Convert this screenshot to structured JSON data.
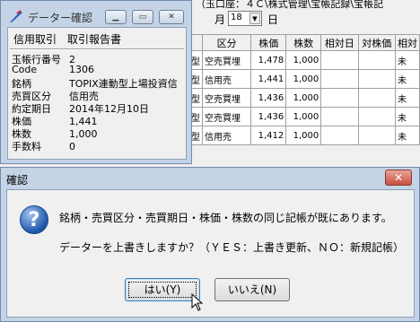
{
  "background": {
    "top_text": "（玉口座：４Ｃ\\株式管理\\宝帳記録\\宝帳記",
    "month_label": "月",
    "day_value": "18",
    "day_label": "日",
    "table": {
      "columns": [
        "区分",
        "株価",
        "株数",
        "相対日",
        "対株価",
        "相対"
      ],
      "rows": [
        [
          "型",
          "空売買埋",
          "1,478",
          "1,000",
          "",
          "",
          "未"
        ],
        [
          "型",
          "信用売",
          "1,441",
          "1,000",
          "",
          "",
          "未"
        ],
        [
          "型",
          "空売買埋",
          "1,436",
          "1,000",
          "",
          "",
          "未"
        ],
        [
          "型",
          "空売買埋",
          "1,436",
          "1,000",
          "",
          "",
          "未"
        ],
        [
          "型",
          "信用売",
          "1,412",
          "1,000",
          "",
          "",
          "未"
        ]
      ]
    }
  },
  "data_window": {
    "title": "データー確認",
    "header": "信用取引　取引報告書",
    "fields": [
      {
        "label": "玉帳行番号",
        "value": "2"
      },
      {
        "label": "Code",
        "value": "1306"
      },
      {
        "label": "銘柄",
        "value": "TOPIX連動型上場投資信"
      },
      {
        "label": "売買区分",
        "value": "信用売"
      },
      {
        "label": "約定期日",
        "value": "2014年12月10日"
      },
      {
        "label": "株価",
        "value": "1,441"
      },
      {
        "label": "株数",
        "value": "1,000"
      },
      {
        "label": "手数料",
        "value": "0"
      }
    ]
  },
  "dialog": {
    "title": "確認",
    "close_label": "✕",
    "message_line1": "銘柄・売買区分・売買期日・株価・株数の同じ記帳が既にあります。",
    "message_line2": "データーを上書きしますか？（ＹＥＳ：上書き更新、ＮＯ：新規記帳）",
    "yes_label": "はい(Y)",
    "no_label": "いいえ(N)"
  },
  "colors": {
    "accent": "#1d55a8",
    "close": "#c75040",
    "frame": "#c4d4e6"
  }
}
